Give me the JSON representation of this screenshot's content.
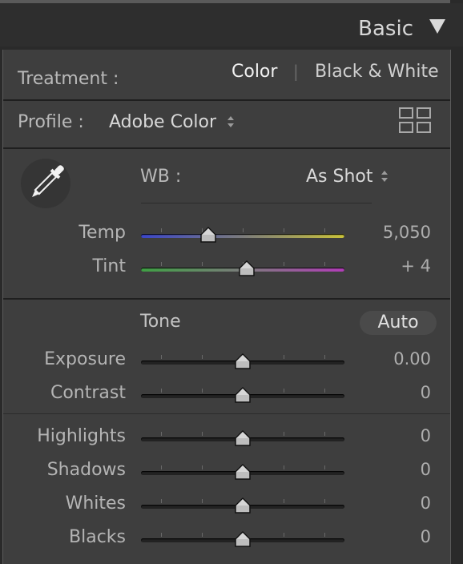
{
  "header": {
    "title": "Basic"
  },
  "treatment": {
    "label": "Treatment :",
    "color": "Color",
    "divider": "|",
    "bw": "Black & White"
  },
  "profile": {
    "label": "Profile :",
    "value": "Adobe Color"
  },
  "wb": {
    "label": "WB :",
    "value": "As Shot"
  },
  "tone": {
    "label": "Tone",
    "auto": "Auto"
  },
  "sliders": [
    {
      "label": "Temp",
      "value": "5,050",
      "level": 0.33
    },
    {
      "label": "Tint",
      "value": "+ 4",
      "level": 0.52
    },
    {
      "label": "Exposure",
      "value": "0.00",
      "level": 0.5
    },
    {
      "label": "Contrast",
      "value": "0",
      "level": 0.5
    },
    {
      "label": "Highlights",
      "value": "0",
      "level": 0.5
    },
    {
      "label": "Shadows",
      "value": "0",
      "level": 0.5
    },
    {
      "label": "Whites",
      "value": "0",
      "level": 0.5
    },
    {
      "label": "Blacks",
      "value": "0",
      "level": 0.5
    }
  ],
  "colors": {
    "tempStart": "#3b46c8",
    "tempEnd": "#c9c23a",
    "tintStart": "#3fa044",
    "tintEnd": "#b23db8"
  },
  "icons": [
    "collapse-triangle-icon",
    "profile-browser-grid-icon",
    "eyedropper-icon",
    "stepper-icon"
  ]
}
